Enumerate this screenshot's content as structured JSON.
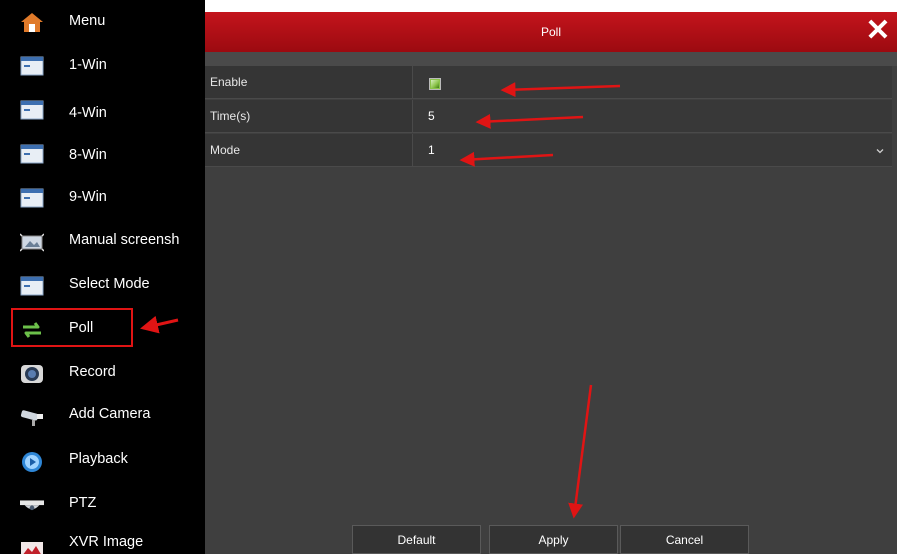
{
  "menu": {
    "items": [
      {
        "label": "Menu",
        "icon": "home-icon"
      },
      {
        "label": "1-Win",
        "icon": "window-icon"
      },
      {
        "label": "4-Win",
        "icon": "window-icon"
      },
      {
        "label": "8-Win",
        "icon": "window-icon"
      },
      {
        "label": "9-Win",
        "icon": "window-icon"
      },
      {
        "label": "Manual screensh",
        "icon": "screenshot-icon"
      },
      {
        "label": "Select Mode",
        "icon": "window-icon"
      },
      {
        "label": "Poll",
        "icon": "poll-icon"
      },
      {
        "label": "Record",
        "icon": "record-icon"
      },
      {
        "label": "Add Camera",
        "icon": "camera-icon"
      },
      {
        "label": "Playback",
        "icon": "playback-icon"
      },
      {
        "label": "PTZ",
        "icon": "ptz-icon"
      },
      {
        "label": "XVR Image",
        "icon": "image-icon"
      }
    ],
    "highlighted_item": "Poll"
  },
  "dialog": {
    "title": "Poll",
    "close_symbol": "✕",
    "rows": [
      {
        "label": "Enable",
        "checked": true
      },
      {
        "label": "Time(s)",
        "value": "5"
      },
      {
        "label": "Mode",
        "value": "1"
      }
    ],
    "buttons": {
      "default": "Default",
      "apply": "Apply",
      "cancel": "Cancel"
    }
  },
  "colors": {
    "title_bar": "#b0101a",
    "annotation_arrow": "#e01414",
    "checkbox_green": "#8bc34a"
  }
}
